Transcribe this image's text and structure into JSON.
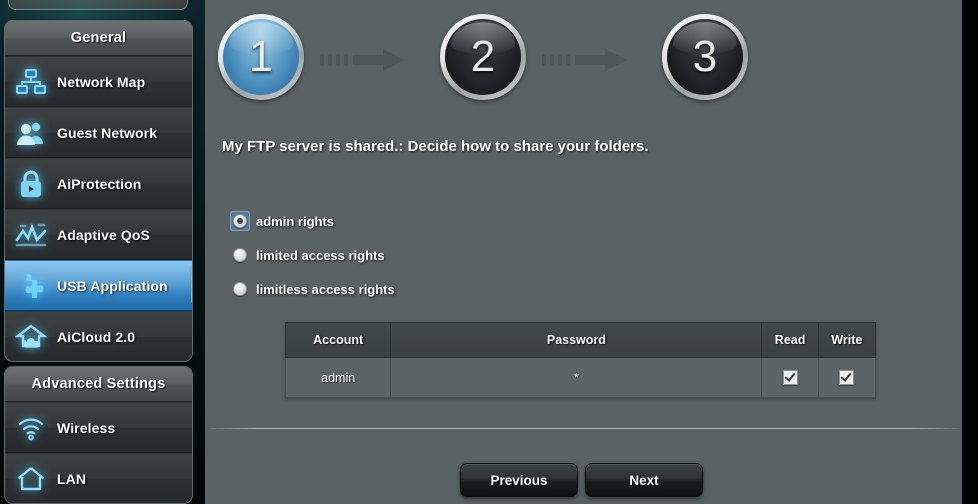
{
  "sidebar": {
    "groups": [
      {
        "title": "General",
        "items": [
          {
            "label": "Network Map",
            "icon": "network-map-icon",
            "active": false
          },
          {
            "label": "Guest Network",
            "icon": "guest-network-icon",
            "active": false
          },
          {
            "label": "AiProtection",
            "icon": "lock-shield-icon",
            "active": false
          },
          {
            "label": "Adaptive QoS",
            "icon": "qos-chart-icon",
            "active": false
          },
          {
            "label": "USB Application",
            "icon": "puzzle-piece-icon",
            "active": true
          },
          {
            "label": "AiCloud 2.0",
            "icon": "cloud-home-icon",
            "active": false
          }
        ]
      },
      {
        "title": "Advanced Settings",
        "items": [
          {
            "label": "Wireless",
            "icon": "wifi-icon",
            "active": false
          },
          {
            "label": "LAN",
            "icon": "house-icon",
            "active": false
          }
        ]
      }
    ]
  },
  "wizard": {
    "steps": [
      {
        "number": "1",
        "state": "current"
      },
      {
        "number": "2",
        "state": "pending"
      },
      {
        "number": "3",
        "state": "pending"
      }
    ],
    "subtitle": "My FTP server is shared.: Decide how to share your folders.",
    "options": [
      {
        "label": "admin rights",
        "selected": true,
        "focused": true
      },
      {
        "label": "limited access rights",
        "selected": false,
        "focused": false
      },
      {
        "label": "limitless access rights",
        "selected": false,
        "focused": false
      }
    ],
    "table": {
      "headers": [
        "Account",
        "Password",
        "Read",
        "Write"
      ],
      "rows": [
        {
          "account": "admin",
          "password": "*",
          "read": true,
          "write": true
        }
      ]
    },
    "buttons": {
      "previous": "Previous",
      "next": "Next"
    }
  },
  "colors": {
    "accent_blue": "#2f7fbe",
    "panel_bg": "#596366",
    "sidebar_bg": "#0a1d21",
    "icon_glow": "#5ac8ff",
    "table_header": "#3a4245",
    "table_cell": "#5b6568"
  }
}
